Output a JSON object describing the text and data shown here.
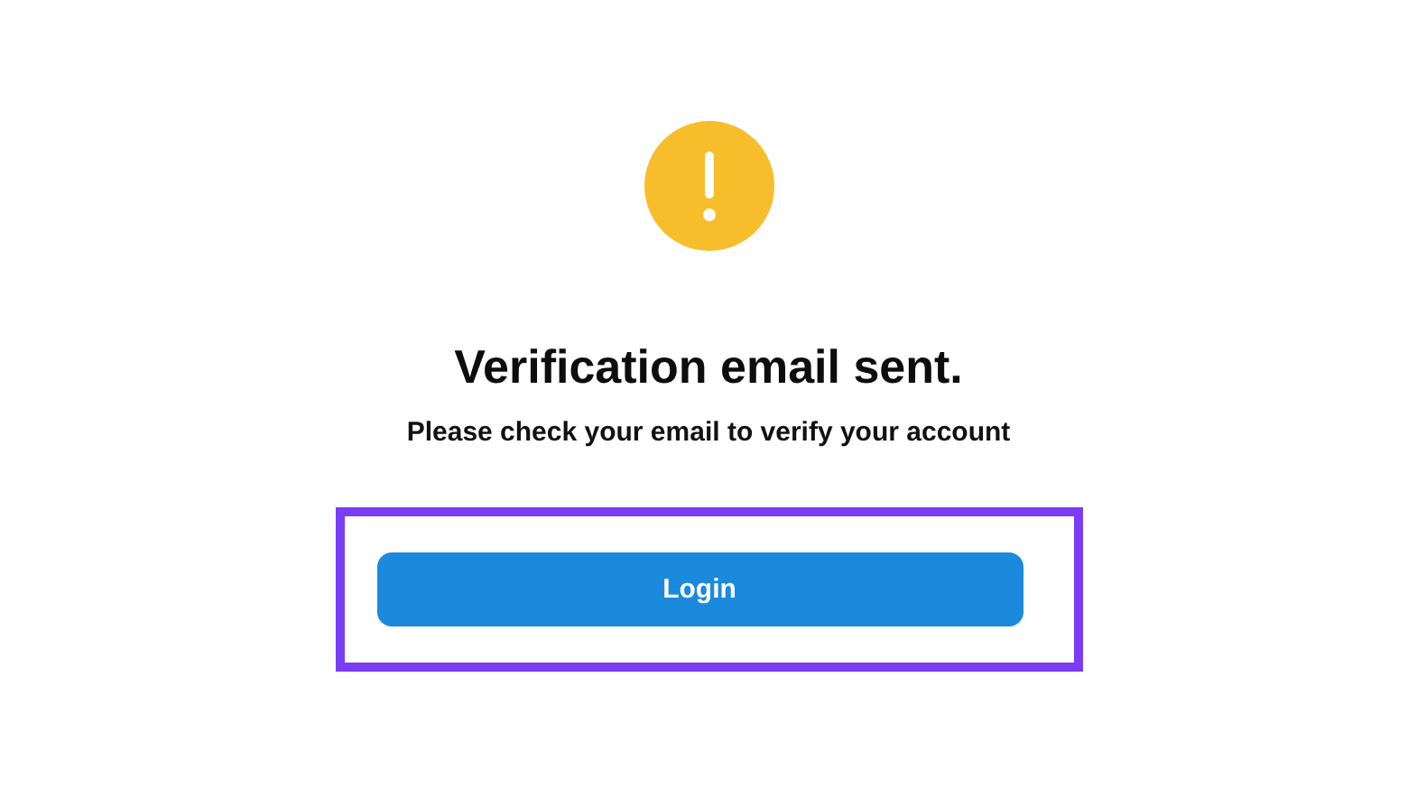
{
  "notice": {
    "kind": "warning",
    "title": "Verification email sent.",
    "message": "Please check your email to verify your account"
  },
  "buttons": [
    {
      "label": "Login"
    }
  ]
}
